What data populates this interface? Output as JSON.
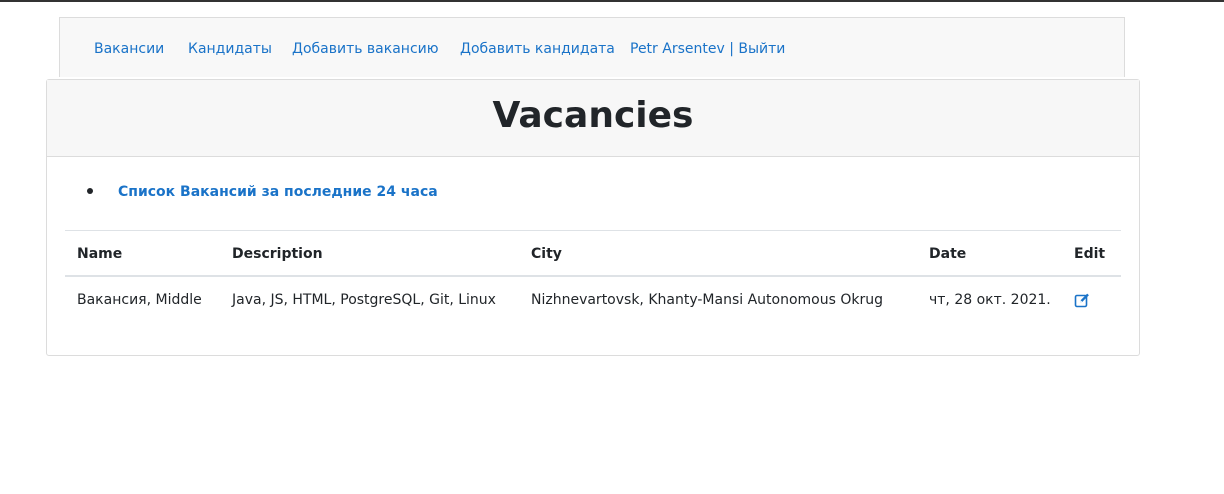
{
  "nav": {
    "items": [
      {
        "label": "Вакансии"
      },
      {
        "label": "Кандидаты"
      },
      {
        "label": "Добавить вакансию"
      },
      {
        "label": "Добавить кандидата"
      },
      {
        "label": "Petr Arsentev | Выйти"
      }
    ]
  },
  "card": {
    "title": "Vacancies",
    "link": "Список Вакансий за последние 24 часа"
  },
  "table": {
    "headers": [
      "Name",
      "Description",
      "City",
      "Date",
      "Edit"
    ],
    "rows": [
      {
        "name": "Вакансия, Middle",
        "description": "Java, JS, HTML, PostgreSQL, Git, Linux",
        "city": "Nizhnevartovsk, Khanty-Mansi Autonomous Okrug",
        "date": "чт, 28 окт. 2021.",
        "edit_icon": "edit-icon"
      }
    ]
  },
  "colors": {
    "link": "#1a73c8",
    "text": "#212529",
    "header_bg": "#f7f7f7",
    "nav_bg": "#f8f8f8"
  }
}
